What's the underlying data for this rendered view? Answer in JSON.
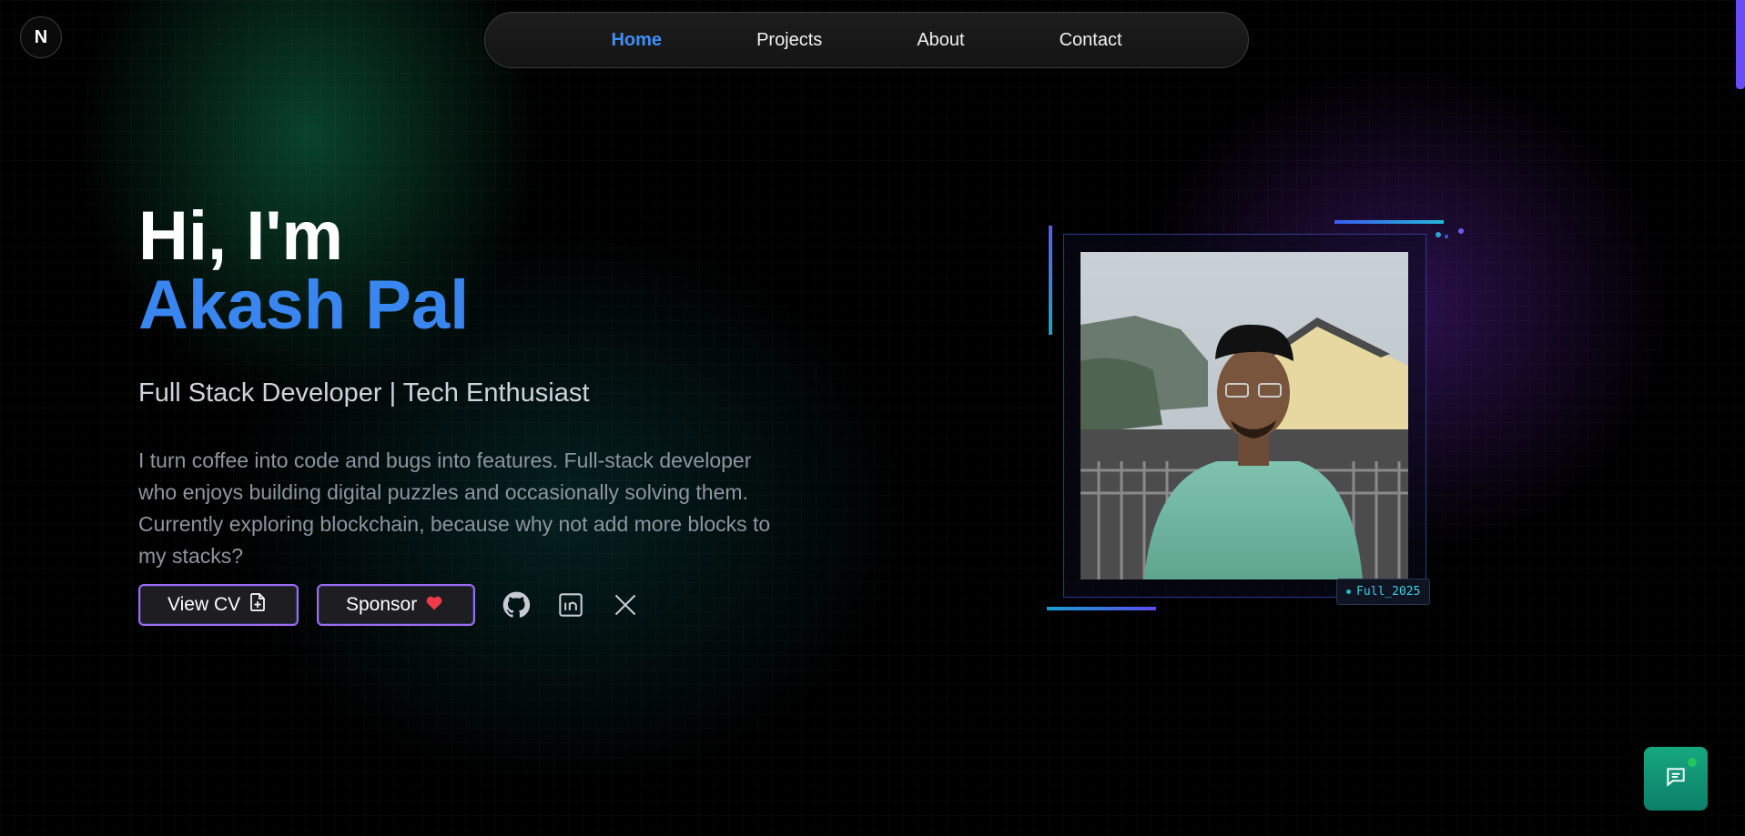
{
  "logo": {
    "text": "N"
  },
  "nav": {
    "items": [
      {
        "label": "Home",
        "active": true
      },
      {
        "label": "Projects",
        "active": false
      },
      {
        "label": "About",
        "active": false
      },
      {
        "label": "Contact",
        "active": false
      }
    ]
  },
  "hero": {
    "greeting": "Hi, I'm",
    "name": "Akash Pal",
    "role": "Full Stack Developer | Tech Enthusiast",
    "bio": "I turn coffee into code and bugs into features. Full-stack developer who enjoys building digital puzzles and occasionally solving them. Currently exploring blockchain, because why not add more blocks to my stacks?"
  },
  "actions": {
    "view_cv_label": "View CV",
    "sponsor_label": "Sponsor",
    "social": [
      "github-icon",
      "linkedin-icon",
      "x-icon"
    ]
  },
  "photo": {
    "badge": "Full_2025"
  },
  "colors": {
    "accent": "#3a86f0",
    "button_border": "#9d6cf5",
    "chat_button": "#16a880",
    "badge_text": "#38d0e0"
  },
  "icons": {
    "cv_button": "file-plus-icon",
    "sponsor_button": "heart-icon",
    "chat": "chat-icon"
  }
}
